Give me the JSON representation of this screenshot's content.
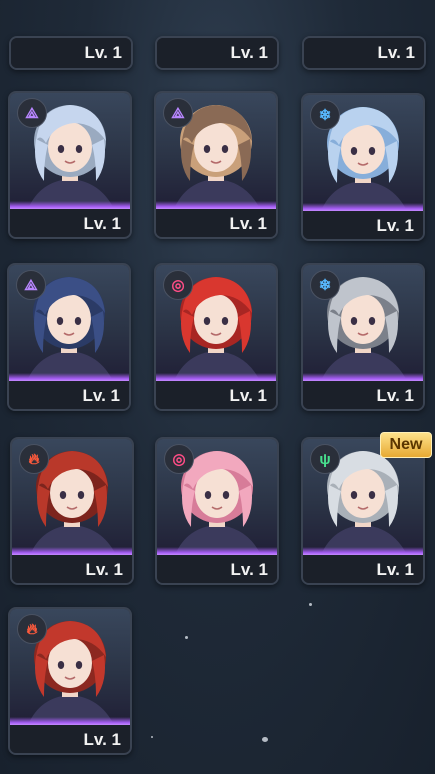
{
  "top_row": [
    {
      "level": "Lv. 1"
    },
    {
      "level": "Lv. 1"
    },
    {
      "level": "Lv. 1"
    }
  ],
  "cards": [
    {
      "name": "card-silver-twintail",
      "element": "purple",
      "element_icon": "triangle-shard-icon",
      "hair": "#c6d6ee",
      "accent": "#9aaac0",
      "level": "Lv. 1"
    },
    {
      "name": "card-mouse-ears",
      "element": "purple",
      "element_icon": "triangle-shard-icon",
      "hair": "#8a6a55",
      "accent": "#c9a07a",
      "level": "Lv. 1"
    },
    {
      "name": "card-blue-bun",
      "element": "ice",
      "element_icon": "snowflake-icon",
      "hair": "#b9d2ef",
      "accent": "#87aeda",
      "level": "Lv. 1"
    },
    {
      "name": "card-navy-man",
      "element": "purple",
      "element_icon": "triangle-shard-icon",
      "hair": "#3b4f86",
      "accent": "#2b3b66",
      "level": "Lv. 1"
    },
    {
      "name": "card-red-short",
      "element": "pink",
      "element_icon": "spiral-icon",
      "hair": "#d9372f",
      "accent": "#a82623",
      "level": "Lv. 1"
    },
    {
      "name": "card-grey-cap",
      "element": "ice",
      "element_icon": "snowflake-icon",
      "hair": "#bfc4cc",
      "accent": "#7b808a",
      "level": "Lv. 1"
    },
    {
      "name": "card-red-glasses",
      "element": "fire",
      "element_icon": "flame-icon",
      "hair": "#b9382a",
      "accent": "#7d241d",
      "level": "Lv. 1"
    },
    {
      "name": "card-pink-bow",
      "element": "pink",
      "element_icon": "spiral-icon",
      "hair": "#f2a8be",
      "accent": "#d77c99",
      "level": "Lv. 1"
    },
    {
      "name": "card-white-long",
      "element": "wind",
      "element_icon": "wind-claw-icon",
      "hair": "#d8dde3",
      "accent": "#a9b0b8",
      "level": "Lv. 1",
      "badge": "New"
    },
    {
      "name": "card-red-ponytail",
      "element": "fire",
      "element_icon": "flame-icon",
      "hair": "#c2382c",
      "accent": "#8c2820",
      "level": "Lv. 1"
    }
  ]
}
